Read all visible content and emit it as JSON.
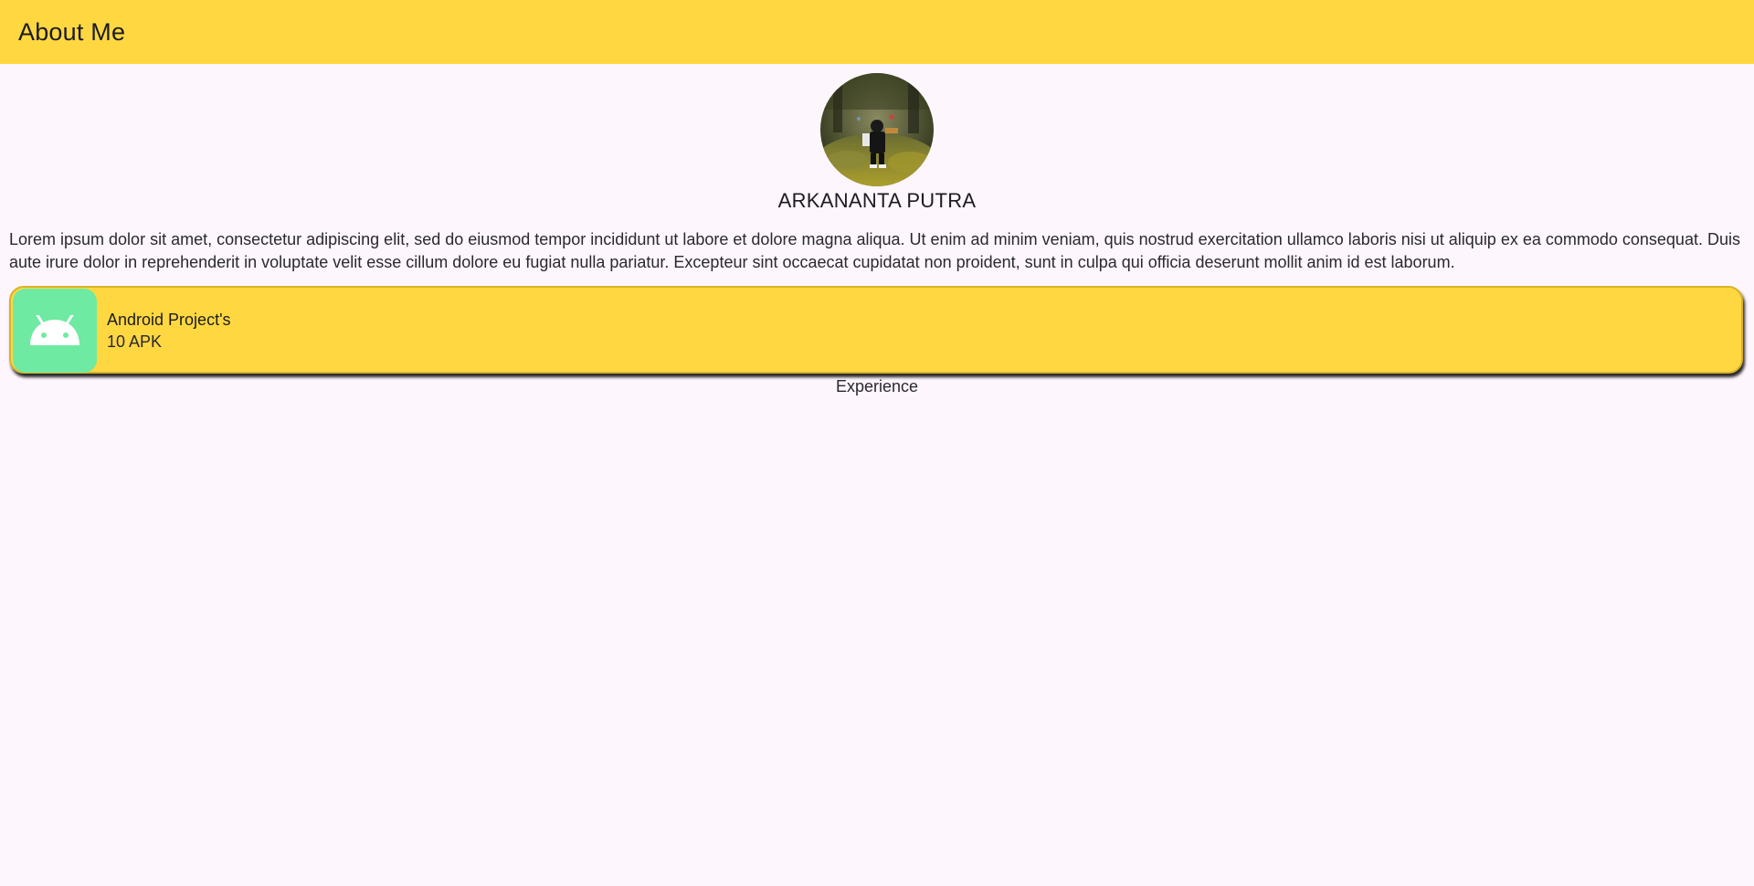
{
  "app_bar": {
    "title": "About Me",
    "background": "#ffd841"
  },
  "profile": {
    "avatar_icon": "profile-photo",
    "name": "ARKANANTA PUTRA",
    "bio": "Lorem ipsum dolor sit amet, consectetur adipiscing elit, sed do eiusmod tempor incididunt ut labore et dolore magna aliqua. Ut enim ad minim veniam, quis nostrud exercitation ullamco laboris nisi ut aliquip ex ea commodo consequat. Duis aute irure dolor in reprehenderit in voluptate velit esse cillum dolore eu fugiat nulla pariatur. Excepteur sint occaecat cupidatat non proident, sunt in culpa qui officia deserunt mollit anim id est laborum."
  },
  "projects": [
    {
      "icon": "android-icon",
      "icon_background": "#6eeaa3",
      "title": "Android Project's",
      "subtitle": "10 APK"
    }
  ],
  "section_label": "Experience",
  "colors": {
    "page_background": "#fdf6fc",
    "accent": "#ffd841",
    "android_green": "#6eeaa3"
  }
}
